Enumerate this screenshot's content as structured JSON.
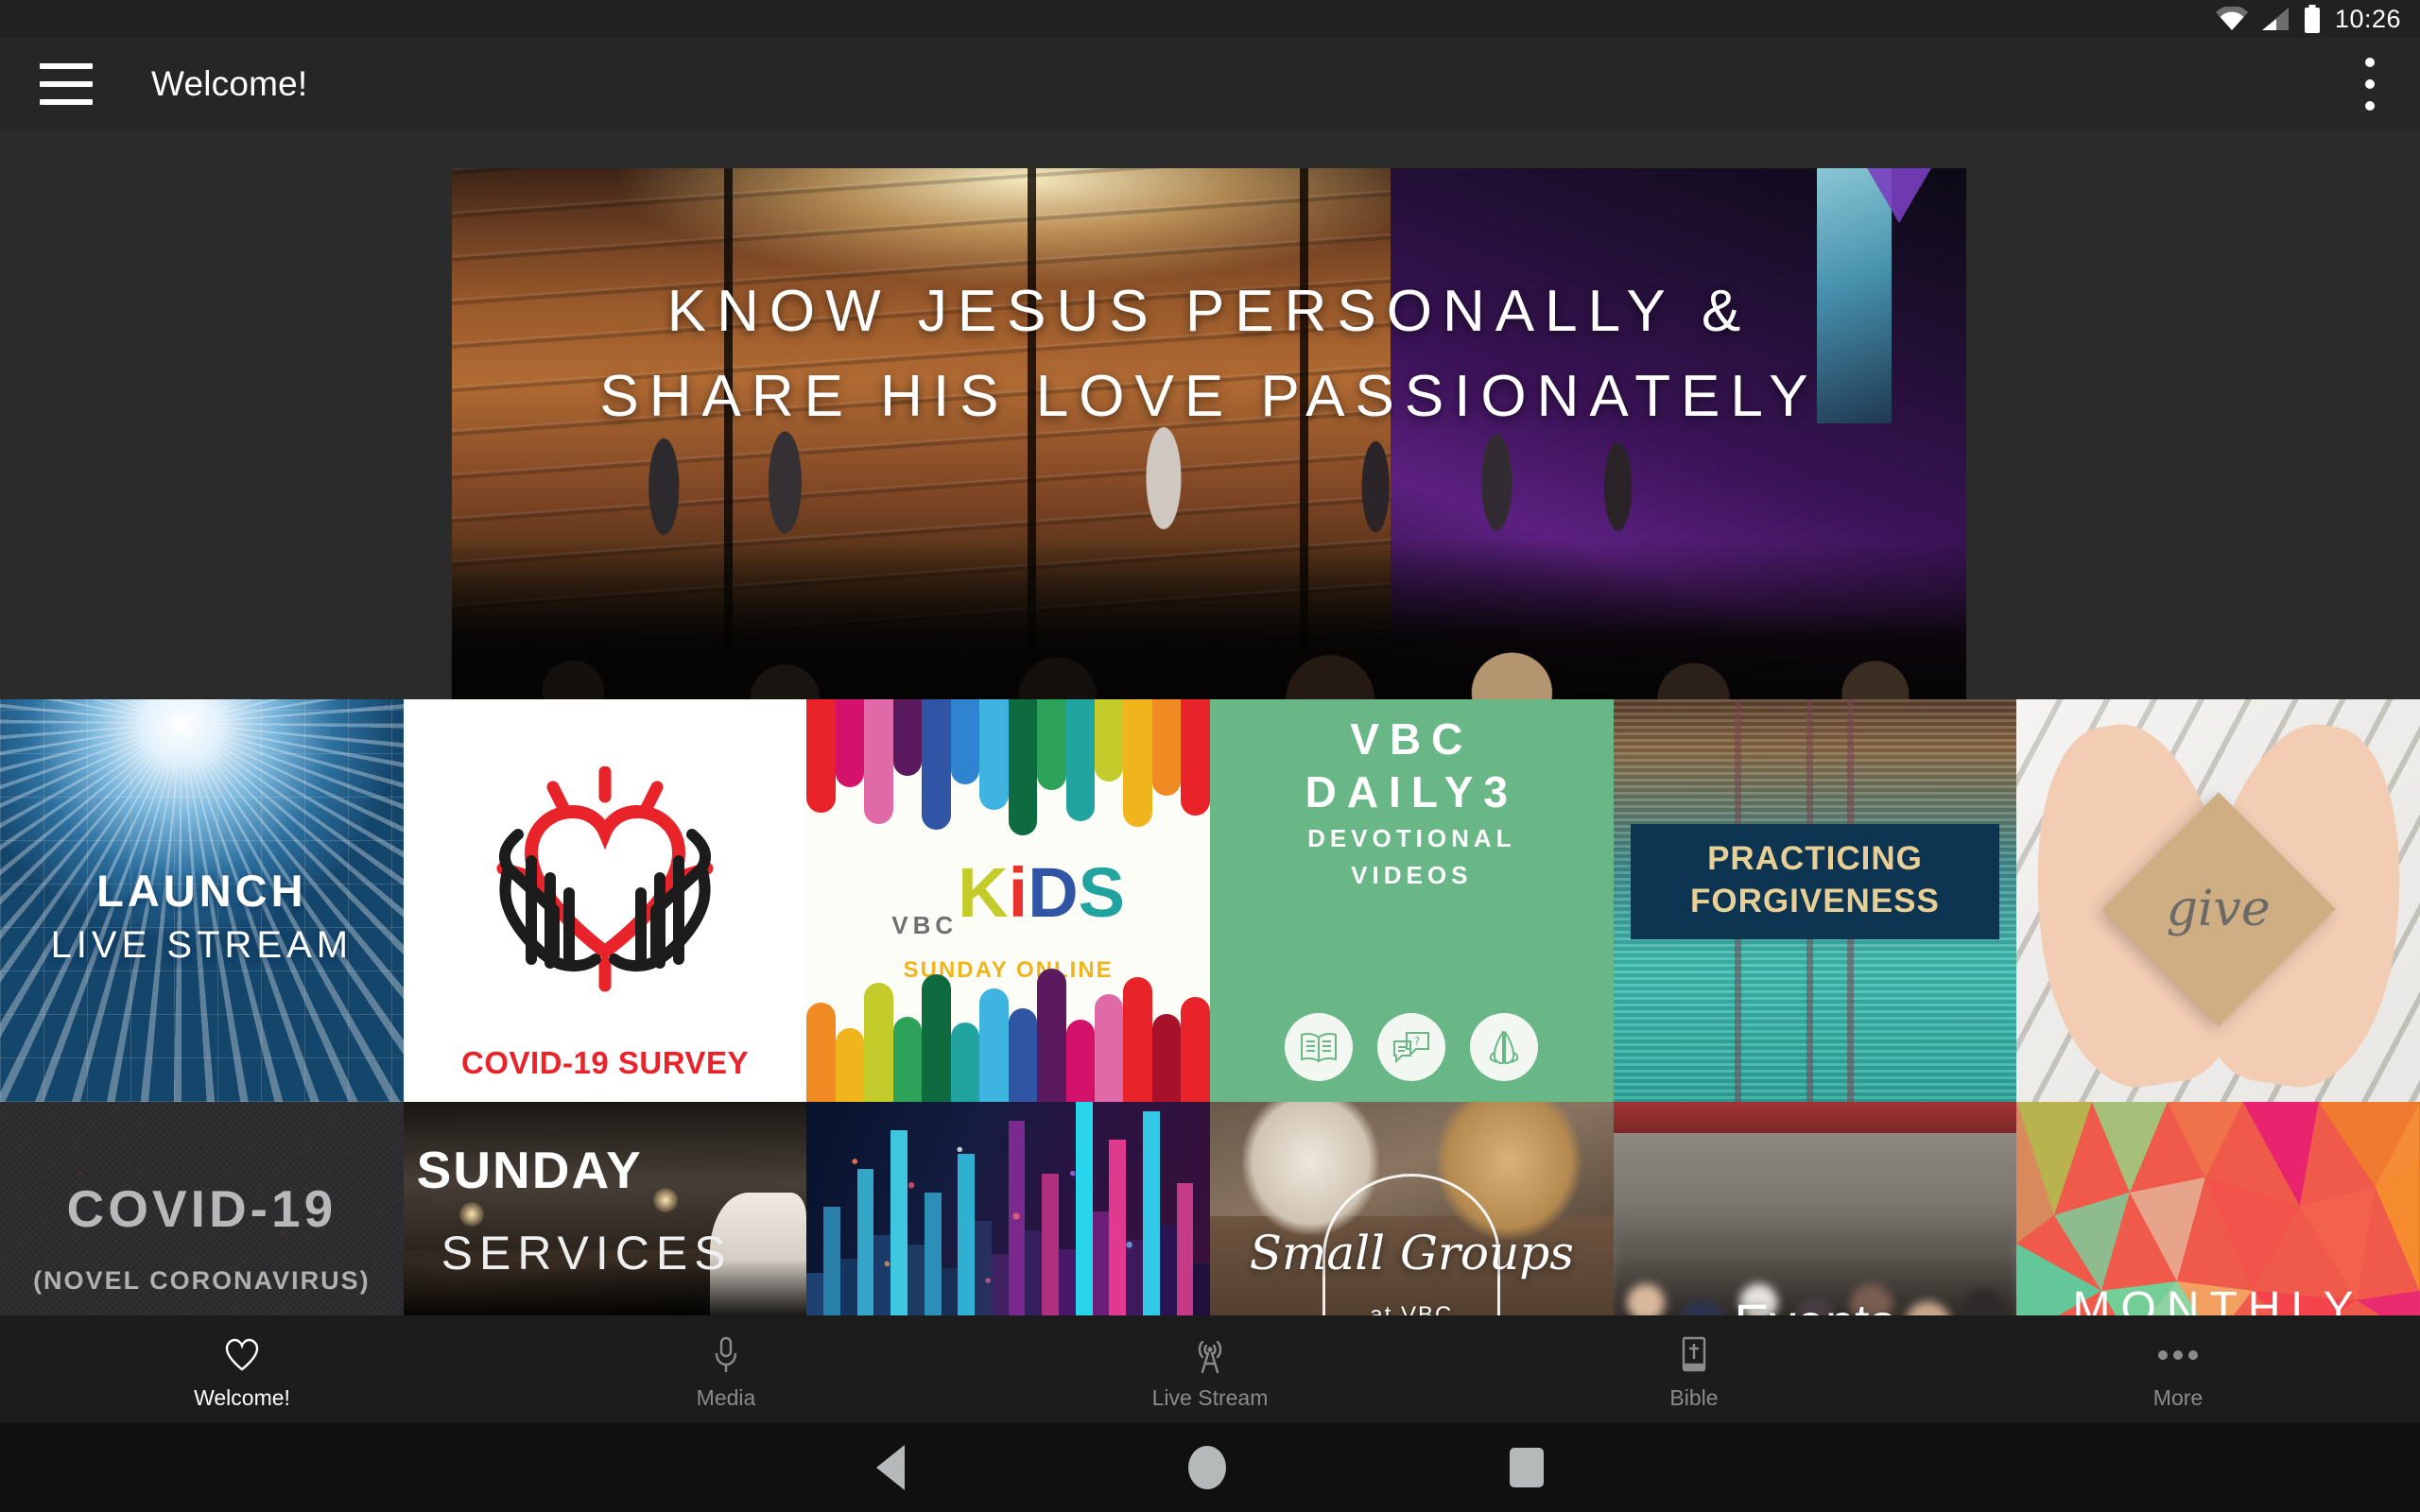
{
  "status_bar": {
    "time": "10:26",
    "icons": [
      "wifi-icon",
      "cellular-signal-icon",
      "battery-icon"
    ]
  },
  "app_bar": {
    "menu_icon": "hamburger-menu-icon",
    "title": "Welcome!",
    "overflow_icon": "overflow-menu-icon"
  },
  "hero": {
    "line1": "KNOW JESUS PERSONALLY &",
    "line2": "SHARE HIS LOVE PASSIONATELY"
  },
  "tiles": {
    "row1": [
      {
        "name": "launch-live-stream",
        "line1": "LAUNCH",
        "line2": "LIVE STREAM"
      },
      {
        "name": "covid-19-survey",
        "caption": "COVID-19 SURVEY"
      },
      {
        "name": "vbc-kids-sunday-online",
        "brand": "VBC",
        "k": "K",
        "i": "i",
        "d": "D",
        "s": "S",
        "subtitle": "SUNDAY ONLINE"
      },
      {
        "name": "vbc-daily-3-devotional-videos",
        "line1": "VBC",
        "line2": "DAILY3",
        "line3": "DEVOTIONAL",
        "line4": "VIDEOS",
        "icons": [
          "open-book-icon",
          "speech-bubble-question-icon",
          "praying-hands-icon"
        ]
      },
      {
        "name": "practicing-forgiveness",
        "line1": "PRACTICING",
        "line2": "FORGIVENESS"
      },
      {
        "name": "give",
        "word": "give"
      }
    ],
    "row2": [
      {
        "name": "covid-19-novel-coronavirus",
        "line1": "COVID-19",
        "line2": "(NOVEL CORONAVIRUS)"
      },
      {
        "name": "sunday-services",
        "line1": "SUNDAY",
        "line2": "SERVICES"
      },
      {
        "name": "media-waveform",
        "label": ""
      },
      {
        "name": "small-groups-at-vbc",
        "line1": "Small Groups",
        "line2": "at VBC"
      },
      {
        "name": "events",
        "label": "Events"
      },
      {
        "name": "monthly",
        "label": "MONTHLY"
      }
    ]
  },
  "bottom_nav": {
    "items": [
      {
        "label": "Welcome!",
        "icon": "heart-icon",
        "active": true
      },
      {
        "label": "Media",
        "icon": "microphone-icon",
        "active": false
      },
      {
        "label": "Live Stream",
        "icon": "broadcast-tower-icon",
        "active": false
      },
      {
        "label": "Bible",
        "icon": "bible-book-icon",
        "active": false
      },
      {
        "label": "More",
        "icon": "ellipsis-icon",
        "active": false
      }
    ]
  },
  "system_nav": {
    "back": "back-triangle-icon",
    "home": "home-circle-icon",
    "recents": "recents-square-icon"
  },
  "colors": {
    "app_bar": "#262626",
    "status_bar": "#212121",
    "content_bg": "#2b2b2b",
    "bottom_nav": "#1c1c1c",
    "system_nav": "#101010",
    "active_nav": "#ffffff",
    "inactive_nav": "#8b8b8b",
    "daily3_green": "#69b787",
    "survey_red": "#e8232a",
    "forgiveness_navy": "#0d3552",
    "forgiveness_tan": "#e8cf96"
  }
}
